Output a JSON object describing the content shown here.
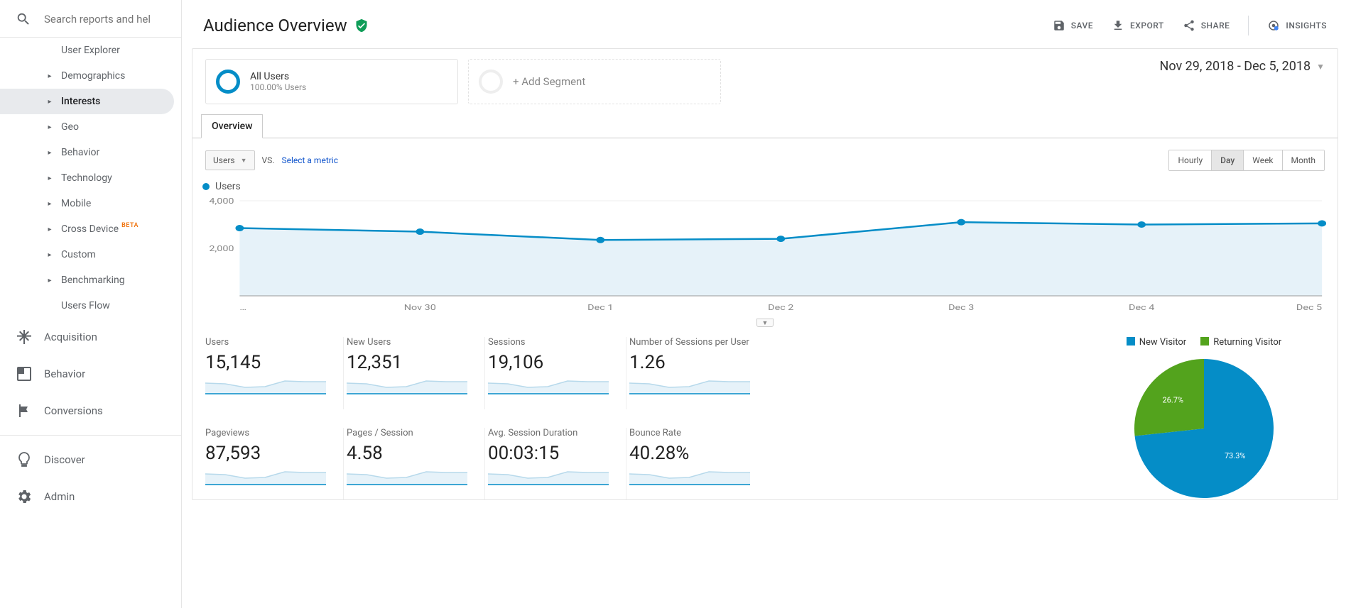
{
  "search": {
    "placeholder": "Search reports and help"
  },
  "sidebar": {
    "sub_items": [
      {
        "label": "User Explorer",
        "arrow": false
      },
      {
        "label": "Demographics",
        "arrow": true
      },
      {
        "label": "Interests",
        "arrow": true,
        "active": true
      },
      {
        "label": "Geo",
        "arrow": true
      },
      {
        "label": "Behavior",
        "arrow": true
      },
      {
        "label": "Technology",
        "arrow": true
      },
      {
        "label": "Mobile",
        "arrow": true
      },
      {
        "label": "Cross Device",
        "arrow": true,
        "beta": "BETA"
      },
      {
        "label": "Custom",
        "arrow": true
      },
      {
        "label": "Benchmarking",
        "arrow": true
      },
      {
        "label": "Users Flow",
        "arrow": false
      }
    ],
    "main_items": [
      {
        "label": "Acquisition",
        "icon": "acquisition"
      },
      {
        "label": "Behavior",
        "icon": "behavior"
      },
      {
        "label": "Conversions",
        "icon": "conversions"
      },
      {
        "label": "Discover",
        "icon": "discover"
      },
      {
        "label": "Admin",
        "icon": "admin"
      }
    ]
  },
  "header": {
    "title": "Audience Overview",
    "actions": {
      "save": "SAVE",
      "export": "EXPORT",
      "share": "SHARE",
      "insights": "INSIGHTS"
    }
  },
  "segments": {
    "all_users_title": "All Users",
    "all_users_sub": "100.00% Users",
    "add_segment": "+ Add Segment"
  },
  "date_range": "Nov 29, 2018 - Dec 5, 2018",
  "tab_overview": "Overview",
  "controls": {
    "metric": "Users",
    "vs": "VS.",
    "select_metric": "Select a metric",
    "granularity": [
      "Hourly",
      "Day",
      "Week",
      "Month"
    ],
    "active_gran": "Day"
  },
  "legend_users": "Users",
  "chart_data": {
    "type": "line",
    "x": [
      "…",
      "Nov 30",
      "Dec 1",
      "Dec 2",
      "Dec 3",
      "Dec 4",
      "Dec 5"
    ],
    "series": [
      {
        "name": "Users",
        "values": [
          2850,
          2700,
          2350,
          2400,
          3100,
          3000,
          3050
        ]
      }
    ],
    "ylim": [
      0,
      4000
    ],
    "yticks": [
      2000,
      4000
    ],
    "xlabel": "",
    "ylabel": ""
  },
  "metrics": [
    {
      "label": "Users",
      "value": "15,145"
    },
    {
      "label": "New Users",
      "value": "12,351"
    },
    {
      "label": "Sessions",
      "value": "19,106"
    },
    {
      "label": "Number of Sessions per User",
      "value": "1.26"
    },
    {
      "label": "Pageviews",
      "value": "87,593"
    },
    {
      "label": "Pages / Session",
      "value": "4.58"
    },
    {
      "label": "Avg. Session Duration",
      "value": "00:03:15"
    },
    {
      "label": "Bounce Rate",
      "value": "40.28%"
    }
  ],
  "pie": {
    "legend": [
      {
        "label": "New Visitor",
        "color": "blue"
      },
      {
        "label": "Returning Visitor",
        "color": "green"
      }
    ],
    "slices": [
      {
        "label": "73.3%",
        "value": 73.3,
        "color": "#058dc7"
      },
      {
        "label": "26.7%",
        "value": 26.7,
        "color": "#53a31d"
      }
    ]
  }
}
